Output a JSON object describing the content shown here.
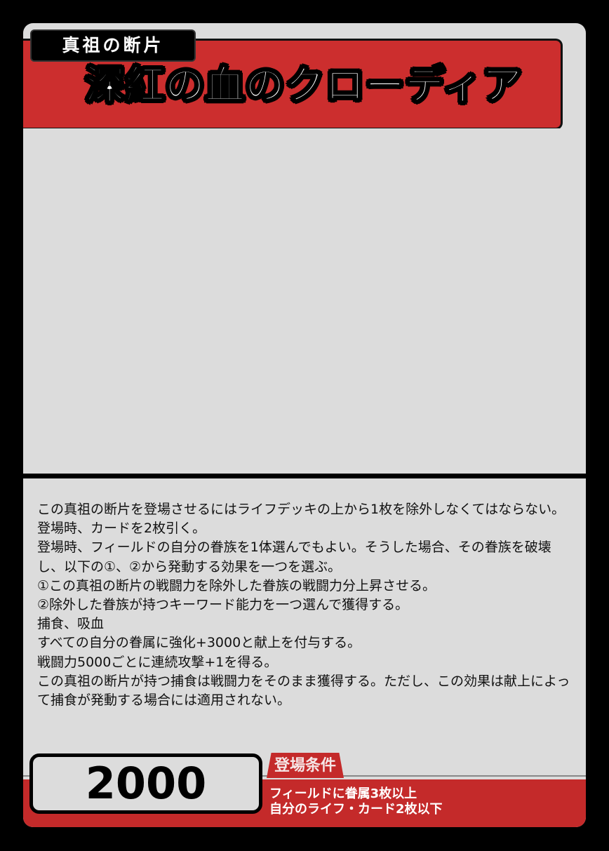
{
  "card": {
    "category": "真祖の断片",
    "name": "深紅の血のクローディア",
    "effect_lines": [
      "この真祖の断片を登場させるにはライフデッキの上から1枚を除外しなくてはならない。",
      "登場時、カードを2枚引く。",
      "登場時、フィールドの自分の眷族を1体選んでもよい。そうした場合、その眷族を破壊し、以下の①、②から発動する効果を一つを選ぶ。",
      "①この真祖の断片の戦闘力を除外した眷族の戦闘力分上昇させる。",
      "②除外した眷族が持つキーワード能力を一つ選んで獲得する。",
      "捕食、吸血",
      "すべての自分の眷属に強化+3000と献上を付与する。",
      "戦闘力5000ごとに連続攻撃+1を得る。",
      "この真祖の断片が持つ捕食は戦闘力をそのまま獲得する。ただし、この効果は献上によって捕食が発動する場合には適用されない。"
    ],
    "power": "2000",
    "condition_label": "登場条件",
    "conditions": [
      "フィールドに眷属3枚以上",
      "自分のライフ・カード2枚以下"
    ]
  },
  "colors": {
    "frame": "#000000",
    "card_bg": "#dcdcdc",
    "accent_red": "#cc2e2e",
    "text": "#111111"
  }
}
